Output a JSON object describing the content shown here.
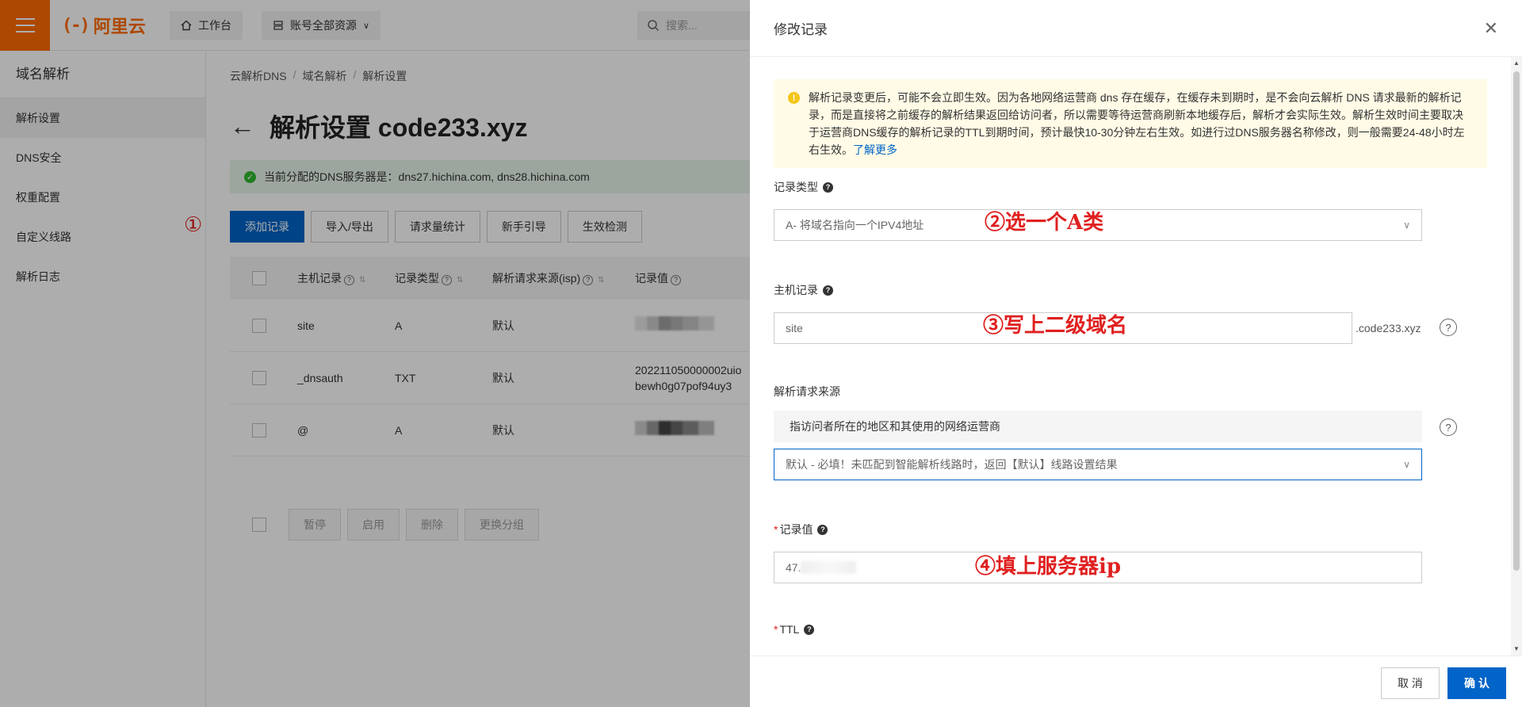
{
  "topbar": {
    "logo_text": "阿里云",
    "logo_mark": "(-)",
    "workbench_label": "工作台",
    "resources_label": "账号全部资源",
    "search_placeholder": "搜索..."
  },
  "sidebar": {
    "title": "域名解析",
    "items": [
      {
        "label": "解析设置"
      },
      {
        "label": "DNS安全"
      },
      {
        "label": "权重配置"
      },
      {
        "label": "自定义线路"
      },
      {
        "label": "解析日志"
      }
    ]
  },
  "main": {
    "breadcrumb": [
      "云解析DNS",
      "域名解析",
      "解析设置"
    ],
    "breadcrumb_sep": "/",
    "title": "解析设置 code233.xyz",
    "dns_notice": "当前分配的DNS服务器是：dns27.hichina.com, dns28.hichina.com",
    "step1_annotation": "①",
    "toolbar": [
      "添加记录",
      "导入/导出",
      "请求量统计",
      "新手引导",
      "生效检测"
    ],
    "table": {
      "headers": [
        "主机记录",
        "记录类型",
        "解析请求来源(isp)",
        "记录值"
      ],
      "rows": [
        {
          "host": "site",
          "type": "A",
          "isp": "默认",
          "value": ""
        },
        {
          "host": "_dnsauth",
          "type": "TXT",
          "isp": "默认",
          "value": "202211050000002uio",
          "value2": "bewh0g07pof94uy3"
        },
        {
          "host": "@",
          "type": "A",
          "isp": "默认",
          "value": ""
        }
      ]
    },
    "bulk_actions": [
      "暂停",
      "启用",
      "删除",
      "更换分组"
    ]
  },
  "drawer": {
    "title": "修改记录",
    "notice_text": "解析记录变更后，可能不会立即生效。因为各地网络运营商 dns 存在缓存，在缓存未到期时，是不会向云解析 DNS 请求最新的解析记录，而是直接将之前缓存的解析结果返回给访问者，所以需要等待运营商刷新本地缓存后，解析才会实际生效。解析生效时间主要取决于运营商DNS缓存的解析记录的TTL到期时间，预计最快10-30分钟左右生效。如进行过DNS服务器名称修改，则一般需要24-48小时左右生效。",
    "notice_link": "了解更多",
    "record_type_label": "记录类型",
    "record_type_value": "A- 将域名指向一个IPV4地址",
    "host_label": "主机记录",
    "host_value": "site",
    "host_suffix": ".code233.xyz",
    "source_label": "解析请求来源",
    "source_desc": "指访问者所在的地区和其使用的网络运营商",
    "source_value": "默认 - 必填！未匹配到智能解析线路时，返回【默认】线路设置结果",
    "value_label": "记录值",
    "value_prefix": "47.",
    "ttl_label": "TTL",
    "annotations": {
      "step2": "②选一个A类",
      "step3": "③写上二级域名",
      "step4": "④填上服务器ip"
    },
    "cancel_label": "取 消",
    "confirm_label": "确 认"
  }
}
